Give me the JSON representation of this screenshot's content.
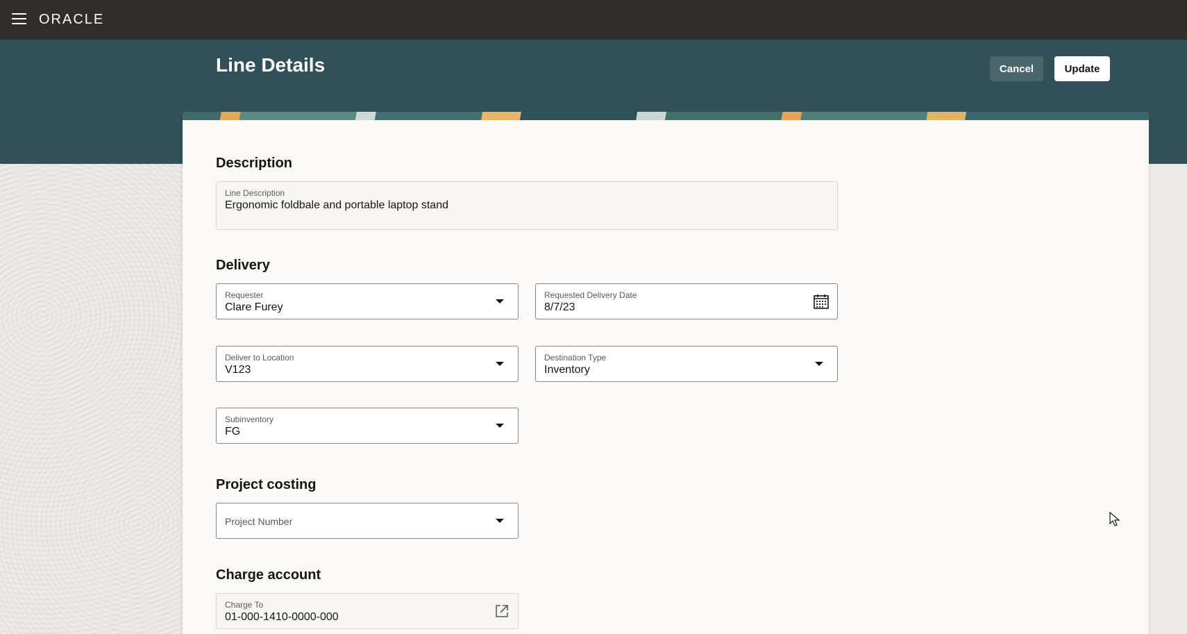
{
  "app": {
    "brand": "ORACLE"
  },
  "page": {
    "title": "Line Details"
  },
  "actions": {
    "cancel_label": "Cancel",
    "update_label": "Update"
  },
  "sections": {
    "description": {
      "title": "Description",
      "line_description": {
        "label": "Line Description",
        "value": "Ergonomic foldbale and portable laptop stand"
      }
    },
    "delivery": {
      "title": "Delivery",
      "requester": {
        "label": "Requester",
        "value": "Clare Furey"
      },
      "requested_delivery_date": {
        "label": "Requested Delivery Date",
        "value": "8/7/23"
      },
      "deliver_to_location": {
        "label": "Deliver to Location",
        "value": "V123"
      },
      "destination_type": {
        "label": "Destination Type",
        "value": "Inventory"
      },
      "subinventory": {
        "label": "Subinventory",
        "value": "FG"
      }
    },
    "project_costing": {
      "title": "Project costing",
      "project_number": {
        "placeholder": "Project Number"
      }
    },
    "charge_account": {
      "title": "Charge account",
      "charge_to": {
        "label": "Charge To",
        "value": "01-000-1410-0000-000"
      }
    }
  },
  "icons": {
    "menu": "hamburger-menu-icon",
    "calendar": "calendar-icon",
    "external_link": "external-link-icon",
    "dropdown": "chevron-down-icon"
  },
  "colors": {
    "topbar": "#312d2a",
    "header_band": "#325057",
    "panel": "#faf9f7",
    "cancel_button": "#4a666c",
    "update_button": "#ffffff"
  }
}
